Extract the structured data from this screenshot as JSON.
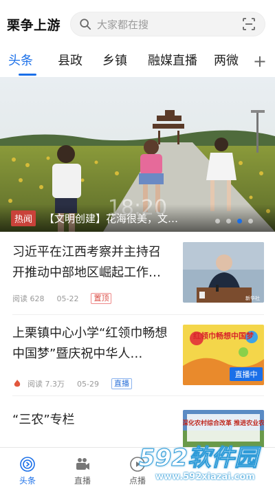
{
  "header": {
    "app_title": "栗争上游",
    "search_placeholder": "大家都在搜"
  },
  "tabs": [
    {
      "label": "头条",
      "active": true
    },
    {
      "label": "县政"
    },
    {
      "label": "乡镇"
    },
    {
      "label": "融媒直播"
    },
    {
      "label": "两微"
    }
  ],
  "tab_add": "+",
  "hero": {
    "badge": "热闻",
    "title": "【文明创建】花海很美，文…",
    "overlay_clock": "18:20",
    "slide_count": 4,
    "active_slide": 3
  },
  "news": [
    {
      "title": "习近平在江西考察并主持召开推动中部地区崛起工作…",
      "reads": "阅读 628",
      "date": "05-22",
      "tag": "置顶",
      "thumb_text": "新华社"
    },
    {
      "title": "上栗镇中心小学“红领巾畅想中国梦”暨庆祝中华人…",
      "reads": "阅读 7.3万",
      "date": "05-29",
      "tag": "直播",
      "thumb_banner": "红领巾畅想中国梦",
      "thumb_live": "直播中"
    },
    {
      "title": "“三农”专栏",
      "thumb_text": "深化农村综合改革 推进农业农"
    }
  ],
  "bottom_nav": [
    {
      "label": "头条",
      "icon": "home-circle-icon",
      "active": true
    },
    {
      "label": "直播",
      "icon": "video-camera-icon"
    },
    {
      "label": "点播",
      "icon": "play-icon"
    }
  ],
  "watermark": {
    "logo": "592软件园",
    "url": "www.592xiazai.com"
  },
  "colors": {
    "accent": "#1a6fe8",
    "hot": "#c9423a",
    "tag_red": "#d94b43"
  }
}
